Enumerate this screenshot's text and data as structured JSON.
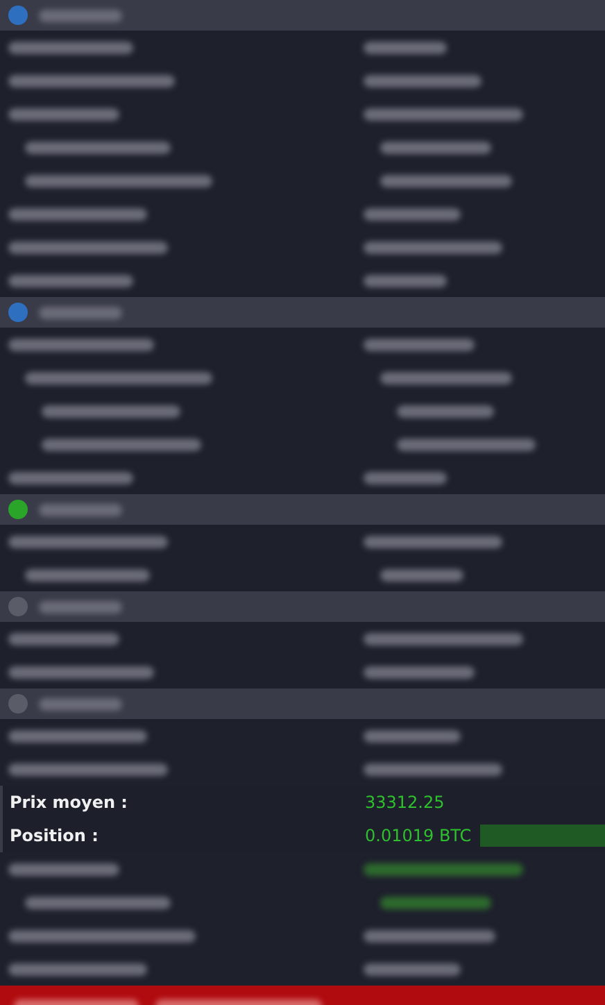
{
  "sections": [
    {
      "color": "#2f6fc0",
      "rows": [
        {
          "kind": "redacted"
        },
        {
          "kind": "redacted"
        },
        {
          "kind": "redacted",
          "children": [
            {
              "kind": "redacted"
            },
            {
              "kind": "redacted"
            }
          ]
        },
        {
          "kind": "redacted"
        },
        {
          "kind": "redacted"
        },
        {
          "kind": "redacted"
        }
      ]
    },
    {
      "color": "#2f6fc0",
      "rows": [
        {
          "kind": "redacted",
          "children": [
            {
              "kind": "redacted",
              "children": [
                {
                  "kind": "redacted"
                },
                {
                  "kind": "redacted"
                }
              ]
            }
          ]
        },
        {
          "kind": "redacted"
        }
      ]
    },
    {
      "color": "#2aa52a",
      "rows": [
        {
          "kind": "redacted",
          "children": [
            {
              "kind": "redacted"
            }
          ]
        }
      ]
    },
    {
      "color": "#5a5c68",
      "rows": [
        {
          "kind": "redacted"
        },
        {
          "kind": "redacted"
        }
      ]
    },
    {
      "color": "#5a5c68",
      "rows": [
        {
          "kind": "redacted"
        },
        {
          "kind": "redacted"
        },
        {
          "kind": "clear",
          "label": "Prix moyen :",
          "value": "33312.25"
        },
        {
          "kind": "clear",
          "label": "Position :",
          "value": "0.01019 BTC",
          "redacted_box": true
        },
        {
          "kind": "redacted-green",
          "children": [
            {
              "kind": "redacted-green"
            }
          ]
        },
        {
          "kind": "redacted"
        },
        {
          "kind": "redacted"
        }
      ]
    }
  ]
}
